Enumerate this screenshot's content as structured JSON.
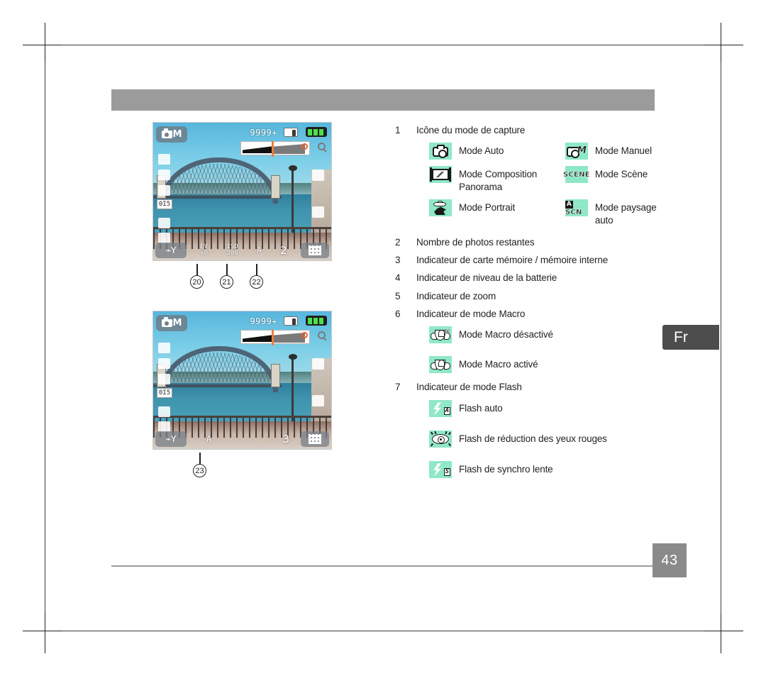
{
  "page": {
    "number": "43",
    "language_tab": "Fr"
  },
  "figure_1": {
    "caption_numbers": [
      "20",
      "21",
      "22"
    ],
    "osd": {
      "mode_badge_letter": "M",
      "shots_remaining": "9999+",
      "zoom_marker": "",
      "bottom_items": [
        {
          "top": "EV",
          "bottom": "+0"
        },
        {
          "top": "ISO",
          "bottom": "200"
        },
        {
          "top": "",
          "bottom": "A"
        }
      ],
      "bottom_big": "2",
      "left_labels": [
        "0I5"
      ]
    }
  },
  "figure_2": {
    "caption_numbers": [
      "23"
    ],
    "osd": {
      "mode_badge_letter": "M",
      "shots_remaining": "9999+",
      "bottom_items": [
        {
          "top": "",
          "bottom": "A"
        }
      ],
      "bottom_big": "3",
      "left_labels": [
        "0I5"
      ]
    }
  },
  "list": [
    {
      "n": "1",
      "text": "Icône du mode de capture"
    },
    {
      "n": "2",
      "text": "Nombre de photos restantes"
    },
    {
      "n": "3",
      "text": "Indicateur de carte mémoire / mémoire interne"
    },
    {
      "n": "4",
      "text": "Indicateur de niveau de la batterie"
    },
    {
      "n": "5",
      "text": "Indicateur de zoom"
    },
    {
      "n": "6",
      "text": "Indicateur de mode Macro"
    },
    {
      "n": "7",
      "text": "Indicateur de mode Flash"
    }
  ],
  "capture_modes": [
    {
      "icon": "camera-auto-icon",
      "label": "Mode Auto"
    },
    {
      "icon": "camera-manual-icon",
      "label": "Mode Manuel",
      "letter": "M"
    },
    {
      "icon": "panorama-icon",
      "label": "Mode Composition Panorama"
    },
    {
      "icon": "scene-icon",
      "label": "Mode Scène",
      "glyph_text": "SCENE"
    },
    {
      "icon": "portrait-icon",
      "label": "Mode Portrait"
    },
    {
      "icon": "auto-scene-icon",
      "label": "Mode paysage auto",
      "glyph_badge": "A",
      "glyph_text": "SCN"
    }
  ],
  "macro_modes": [
    {
      "icon": "macro-off-icon",
      "label": "Mode Macro désactivé",
      "mark": "✕"
    },
    {
      "icon": "macro-on-icon",
      "label": "Mode Macro activé"
    }
  ],
  "flash_modes": [
    {
      "icon": "flash-auto-icon",
      "label": "Flash auto",
      "sub": "A"
    },
    {
      "icon": "flash-redeye-icon",
      "label": "Flash de réduction des yeux rouges"
    },
    {
      "icon": "flash-slow-sync-icon",
      "label": "Flash de synchro lente",
      "sub": "S"
    }
  ],
  "colors": {
    "icon_chip_background": "#8fe8c6",
    "header_bar": "#9b9b9b",
    "page_number_box": "#8a8a8a",
    "language_tab": "#4d4d4d",
    "text": "#231f20"
  }
}
